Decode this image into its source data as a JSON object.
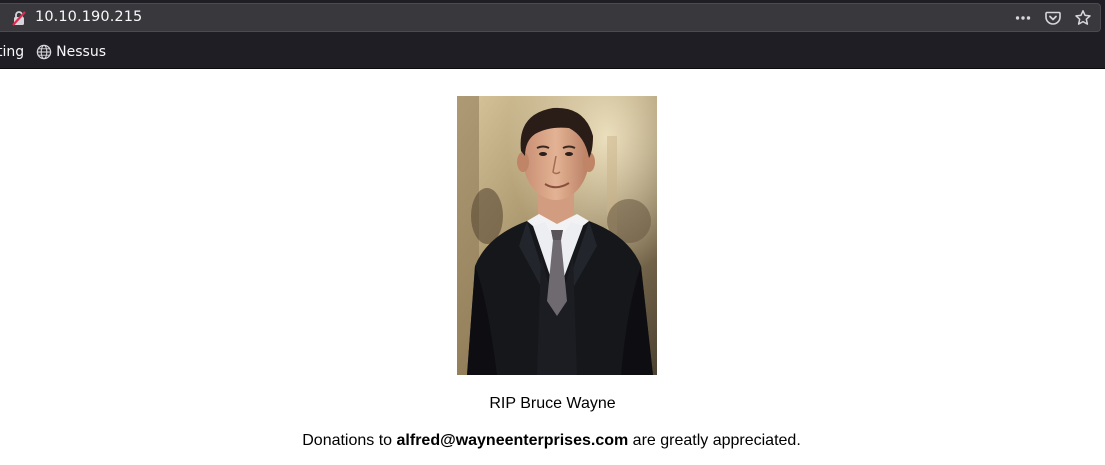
{
  "browser": {
    "url": "10.10.190.215",
    "actions": [
      "more-icon",
      "pocket-icon",
      "bookmark-star-icon"
    ],
    "bookmarks": [
      {
        "label": "ting",
        "icon": "none"
      },
      {
        "label": "Nessus",
        "icon": "globe-icon"
      }
    ]
  },
  "page": {
    "rip_text": "RIP Bruce Wayne",
    "donation": {
      "prefix": "Donations to ",
      "email": "alfred@wayneenterprises.com",
      "suffix": " are greatly appreciated."
    }
  },
  "colors": {
    "chrome_bg": "#1f1e24",
    "urlbar_bg": "#38383d",
    "page_bg": "#ffffff"
  }
}
